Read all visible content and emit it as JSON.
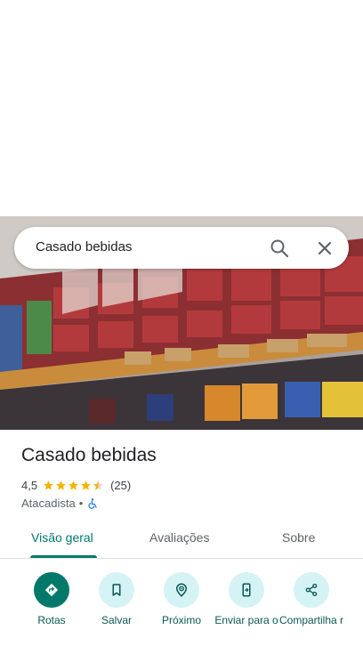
{
  "search": {
    "query": "Casado bebidas"
  },
  "place": {
    "name": "Casado bebidas",
    "rating": "4,5",
    "rating_value": 4.5,
    "review_count": "(25)",
    "category": "Atacadista",
    "separator": "•"
  },
  "tabs": [
    {
      "label": "Visão geral",
      "active": true
    },
    {
      "label": "Avaliações",
      "active": false
    },
    {
      "label": "Sobre",
      "active": false
    }
  ],
  "actions": [
    {
      "label": "Rotas",
      "icon": "directions-icon"
    },
    {
      "label": "Salvar",
      "icon": "bookmark-icon"
    },
    {
      "label": "Próximo",
      "icon": "nearby-icon"
    },
    {
      "label": "Enviar para o",
      "icon": "send-to-phone-icon"
    },
    {
      "label": "Compartilha r",
      "icon": "share-icon"
    }
  ],
  "colors": {
    "accent": "#00796b",
    "action_bg": "#d5f3f5",
    "star": "#f4b400",
    "accessible": "#1a73e8"
  }
}
